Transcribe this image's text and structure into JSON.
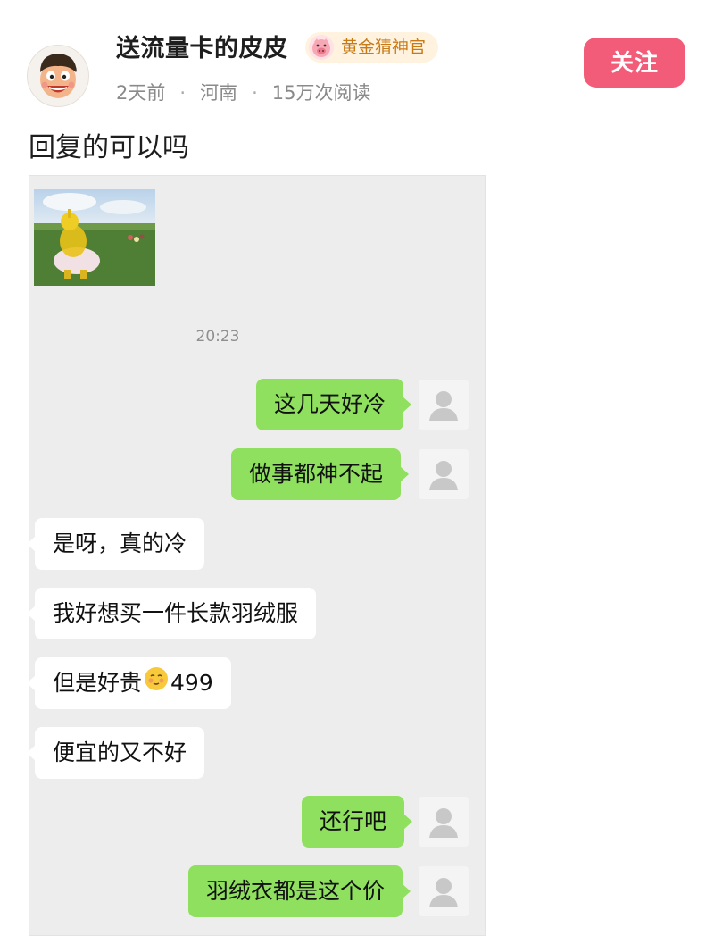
{
  "post": {
    "author": "送流量卡的皮皮",
    "badge": "黄金猜神官",
    "time": "2天前",
    "location": "河南",
    "views": "15万次阅读",
    "separator": "·",
    "follow_label": "关注",
    "text": "回复的可以吗"
  },
  "chat": {
    "timestamp": "20:23",
    "messages": [
      {
        "side": "right",
        "text": "这几天好冷"
      },
      {
        "side": "right",
        "text": "做事都神不起"
      },
      {
        "side": "left",
        "text": "是呀，真的冷"
      },
      {
        "side": "left",
        "text": "我好想买一件长款羽绒服"
      },
      {
        "side": "left",
        "text_before": "但是好贵",
        "emoji": "blush-emoji",
        "text_after": "499"
      },
      {
        "side": "left",
        "text": "便宜的又不好"
      },
      {
        "side": "right",
        "text": "还行吧"
      },
      {
        "side": "right",
        "text": "羽绒衣都是这个价"
      }
    ]
  },
  "colors": {
    "follow": "#f25c78",
    "sent_bubble": "#8fe05e",
    "received_bubble": "#ffffff",
    "chat_background": "#ededed",
    "badge_text": "#c87a16"
  },
  "icons": {
    "author_avatar": "cartoon-face-avatar",
    "badge": "pig-badge-icon",
    "chat_avatar": "default-person-icon",
    "sticker": "teletubby-sticker-image"
  }
}
